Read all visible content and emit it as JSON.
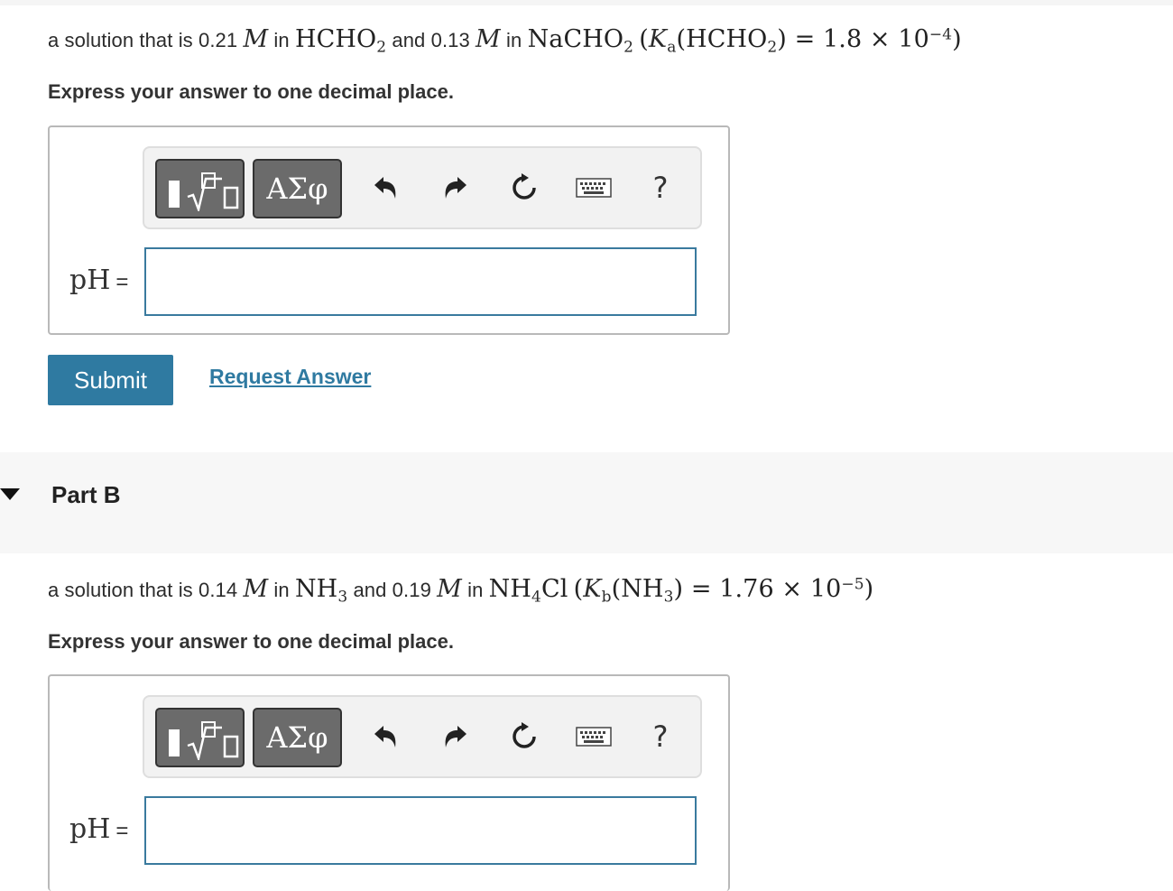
{
  "partA": {
    "question": {
      "prefix": "a solution that is 0.21",
      "unit1": "M",
      "in1": "in",
      "acid": "HCHO",
      "acid_sub": "2",
      "and": "and 0.13",
      "unit2": "M",
      "in2": "in",
      "salt": "NaCHO",
      "salt_sub": "2",
      "k_open": "(",
      "k_symbol": "K",
      "k_sub": "a",
      "k_species": "(HCHO",
      "k_species_sub": "2",
      "k_equals": ") = 1.8 × 10",
      "k_exp": "−4",
      "k_close": ")"
    },
    "instruction": "Express your answer to one decimal place.",
    "toolbar": {
      "templates_icon": "templates-sqrt-icon",
      "greek_label": "ΑΣφ",
      "undo_icon": "undo-icon",
      "redo_icon": "redo-icon",
      "reset_icon": "reset-icon",
      "keyboard_icon": "keyboard-icon",
      "help_label": "?"
    },
    "answer_label": "pH",
    "answer_equals": "=",
    "answer_value": "",
    "submit_label": "Submit",
    "request_label": "Request Answer"
  },
  "partB": {
    "title": "Part B",
    "question": {
      "prefix": "a solution that is 0.14",
      "unit1": "M",
      "in1": "in",
      "base": "NH",
      "base_sub": "3",
      "and": "and 0.19",
      "unit2": "M",
      "in2": "in",
      "salt": "NH",
      "salt_sub": "4",
      "salt_rest": "Cl",
      "k_open": "(",
      "k_symbol": "K",
      "k_sub": "b",
      "k_species": "(NH",
      "k_species_sub": "3",
      "k_equals": ") = 1.76 × 10",
      "k_exp": "−5",
      "k_close": ")"
    },
    "instruction": "Express your answer to one decimal place.",
    "toolbar": {
      "greek_label": "ΑΣφ",
      "help_label": "?"
    },
    "answer_label": "pH",
    "answer_equals": "=",
    "answer_value": ""
  },
  "colors": {
    "accent": "#2f7aa1",
    "toolbar_button": "#6b6b6b",
    "input_border": "#3a7a9e"
  }
}
